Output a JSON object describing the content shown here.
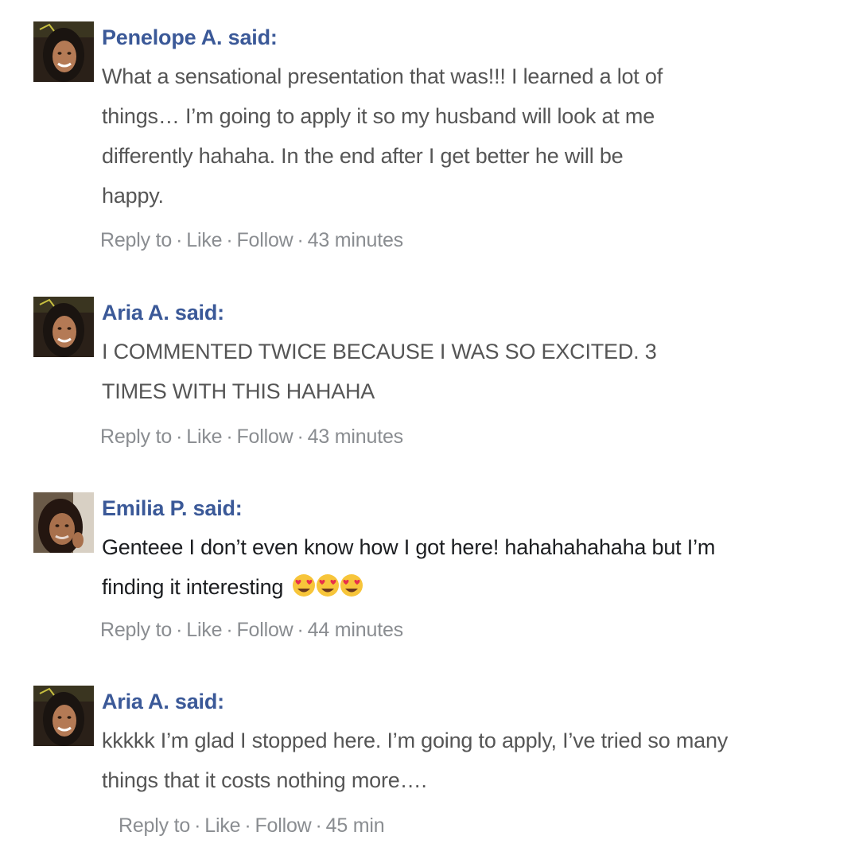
{
  "comments": [
    {
      "author": "Penelope A. said:",
      "text_lines": [
        "What a sensational presentation that was!!! I learned a lot of",
        "things… I’m going to apply it so my husband will look at me",
        "differently hahaha. In the end after I get better he will be",
        "happy."
      ],
      "actions": {
        "reply": "Reply to",
        "like": "Like",
        "follow": "Follow",
        "time": "43 minutes"
      }
    },
    {
      "author": "Aria A. said:",
      "text_lines": [
        "I COMMENTED TWICE BECAUSE I WAS SO EXCITED. 3",
        "TIMES WITH THIS HAHAHA"
      ],
      "actions": {
        "reply": "Reply to",
        "like": "Like",
        "follow": "Follow",
        "time": "43 minutes"
      }
    },
    {
      "author": "Emilia P. said:",
      "text_lines": [
        "Genteee I don’t even know how I got here! hahahahahaha but I’m",
        "finding it interesting"
      ],
      "emoji": [
        "heart-eyes-emoji",
        "heart-eyes-emoji",
        "heart-eyes-emoji"
      ],
      "actions": {
        "reply": "Reply to",
        "like": "Like",
        "follow": "Follow",
        "time": "44 minutes"
      }
    },
    {
      "author": "Aria A. said:",
      "text_lines": [
        "kkkkk I’m glad I stopped here. I’m going to apply, I’ve tried so many",
        "things that it costs nothing more…."
      ],
      "actions": {
        "reply": "Reply to",
        "like": "Like",
        "follow": "Follow",
        "time": "45 min"
      }
    }
  ],
  "separator": "·",
  "colors": {
    "author": "#3b5998",
    "text": "#555555",
    "text_dark": "#1c1e21",
    "actions": "#8a8d91"
  }
}
